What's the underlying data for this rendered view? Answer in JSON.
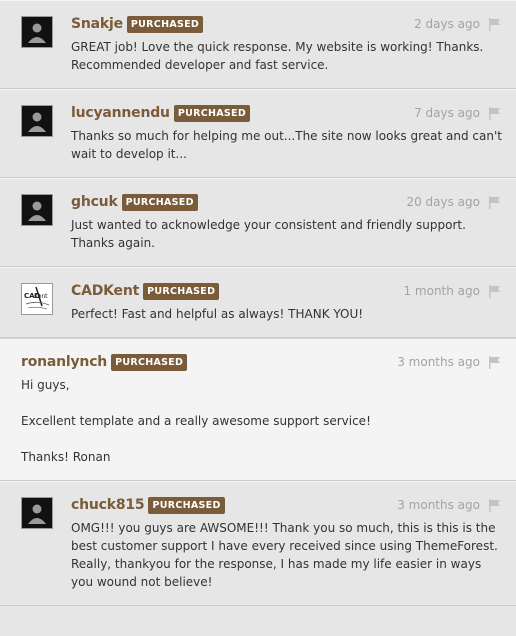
{
  "badge_label": "PURCHASED",
  "colors": {
    "author": "#7a5c3a",
    "badge_bg": "#7a5c3a",
    "date": "#a3a3a3",
    "bg": "#e6e6e6",
    "reply_bg": "#f4f4f4"
  },
  "comments": [
    {
      "author": "Snakje",
      "date": "2 days ago",
      "avatar": "default-avatar",
      "text": [
        "GREAT job! Love the quick response. My website is working! Thanks. Recommended developer and fast service."
      ]
    },
    {
      "author": "lucyannendu",
      "date": "7 days ago",
      "avatar": "default-avatar",
      "text": [
        "Thanks so much for helping me out...The site now looks great and can't wait to develop it..."
      ]
    },
    {
      "author": "ghcuk",
      "date": "20 days ago",
      "avatar": "default-avatar",
      "text": [
        "Just wanted to acknowledge your consistent and friendly support. Thanks again."
      ]
    },
    {
      "author": "CADKent",
      "date": "1 month ago",
      "avatar": "cadkent-logo",
      "text": [
        "Perfect! Fast and helpful as always! THANK YOU!"
      ]
    },
    {
      "author": "ronanlynch",
      "date": "3 months ago",
      "avatar": "none",
      "reply": true,
      "text": [
        "Hi guys,",
        "Excellent template and a really awesome support service!",
        "Thanks! Ronan"
      ]
    },
    {
      "author": "chuck815",
      "date": "3 months ago",
      "avatar": "default-avatar",
      "text": [
        "OMG!!! you guys are AWSOME!!! Thank you so much, this is this is the best customer support I have every received since using ThemeForest. Really, thankyou for the response, I has made my life easier in ways you wound not believe!"
      ]
    }
  ]
}
